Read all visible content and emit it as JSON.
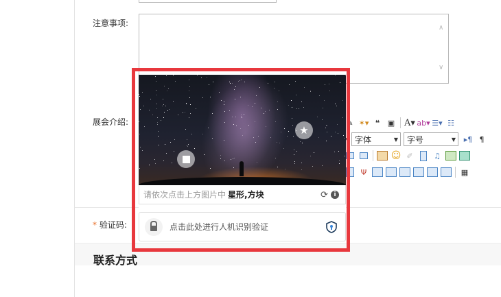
{
  "form": {
    "notes_label": "注意事项:",
    "intro_label": "展会介绍:",
    "captcha_label": "验证码:",
    "required_mark": "*",
    "section_title": "联系方式"
  },
  "editor": {
    "font_select": "字体",
    "size_select": "字号"
  },
  "captcha": {
    "prompt_text": "请依次点击上方图片中",
    "prompt_targets": "星形,方块",
    "verify_text": "点击此处进行人机识别验证",
    "highlight_color": "#e8383d"
  },
  "icons": {
    "refresh": "refresh-icon",
    "info": "info-icon",
    "lock": "lock-icon",
    "shield": "shield-icon",
    "star": "star-marker-icon",
    "square": "square-marker-icon"
  }
}
